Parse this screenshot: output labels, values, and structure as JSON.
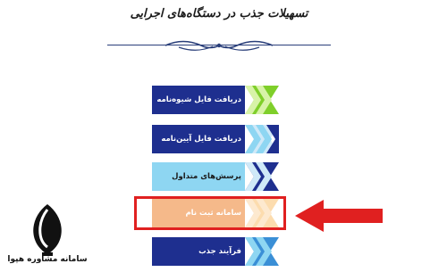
{
  "header": {
    "title": "تسهیلات جذب در دستگاه‌های اجرایی"
  },
  "menu": {
    "items": [
      {
        "label": "دریافت فایل شیوه‌نامه",
        "color": "#1e2f8f",
        "tip": "#7fcf2a"
      },
      {
        "label": "دریافت فایل آیین‌نامه",
        "color": "#1e2f8f",
        "tip": "#cfe9f8"
      },
      {
        "label": "پرسش‌های متداول",
        "color": "#8ed6f2",
        "tip": "#1e2f8f"
      },
      {
        "label": "سامانه ثبت نام",
        "color": "#f5b98a",
        "tip": "#fcdcae"
      },
      {
        "label": "فرآیند جذب",
        "color": "#1e2f8f",
        "tip": "#3a8fd6"
      }
    ]
  },
  "logo": {
    "text": "سامانه مشاوره هپوا"
  },
  "colors": {
    "highlight": "#e02020",
    "accent_blue": "#1e2f8f"
  }
}
